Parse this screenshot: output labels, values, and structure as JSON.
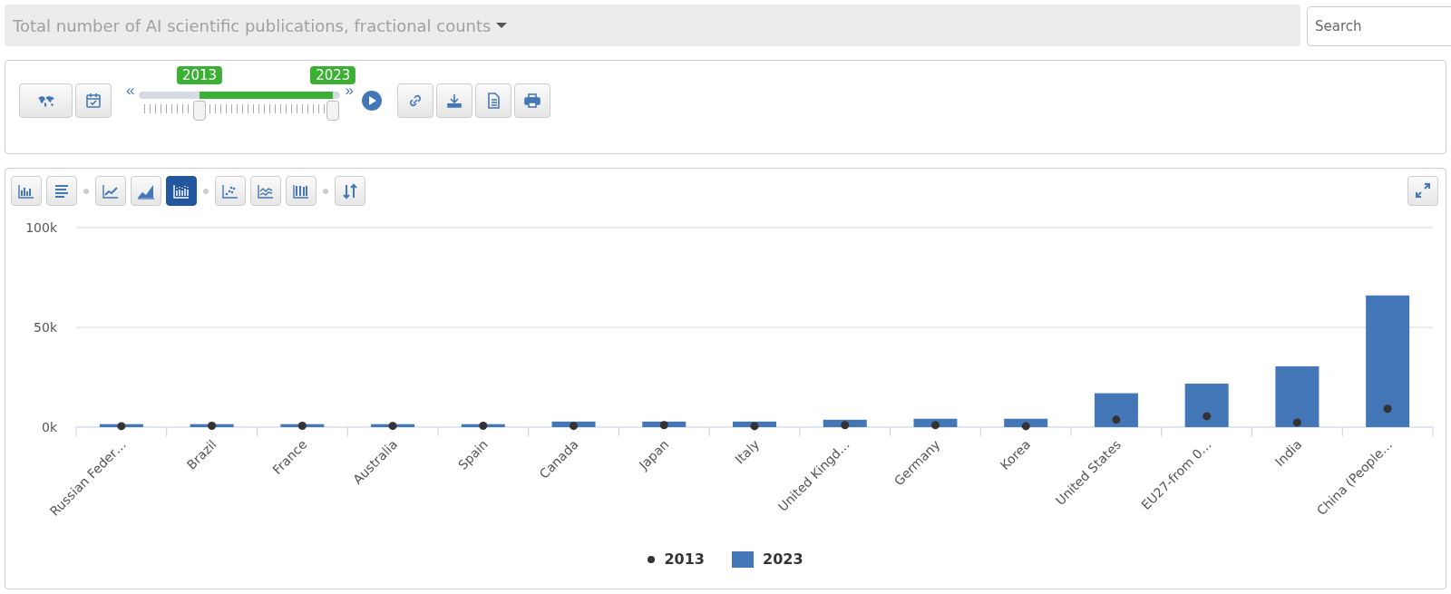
{
  "selector": {
    "title": "Total number of AI scientific publications, fractional counts"
  },
  "search": {
    "placeholder": "Search"
  },
  "range_slider": {
    "prev": "«",
    "next": "»",
    "handles": [
      {
        "label": "2013",
        "level": 0.3
      },
      {
        "label": "2023",
        "level": 0.963
      }
    ]
  },
  "chart_type_groups": [
    [
      {
        "kind": "bar",
        "selected": false
      },
      {
        "kind": "hbar",
        "selected": false
      }
    ],
    [
      {
        "kind": "line",
        "selected": false
      },
      {
        "kind": "area",
        "selected": false
      },
      {
        "kind": "dotbar",
        "selected": true
      }
    ],
    [
      {
        "kind": "scatter",
        "selected": false
      },
      {
        "kind": "multiline",
        "selected": false
      },
      {
        "kind": "stacked",
        "selected": false
      }
    ],
    [
      {
        "kind": "sort",
        "selected": false
      }
    ]
  ],
  "chart": {
    "chart_data": {
      "type": "bar",
      "categories": [
        "Russian Feder…",
        "Brazil",
        "France",
        "Australia",
        "Spain",
        "Canada",
        "Japan",
        "Italy",
        "United Kingd…",
        "Germany",
        "Korea",
        "United States",
        "EU27-from 0…",
        "India",
        "China (People…"
      ],
      "ylim": [
        0,
        100000
      ],
      "yticks": [
        {
          "value": 0,
          "label": "0k"
        },
        {
          "value": 50000,
          "label": "50k"
        },
        {
          "value": 100000,
          "label": "100k"
        }
      ],
      "series": [
        {
          "name": "2013",
          "type": "scatter",
          "color": "#333333",
          "values": [
            500,
            700,
            700,
            600,
            700,
            600,
            1000,
            500,
            1000,
            1000,
            500,
            3700,
            5500,
            2300,
            9200
          ]
        },
        {
          "name": "2023",
          "type": "bar",
          "color": "#4477b8",
          "values": [
            1500,
            1500,
            1500,
            1500,
            1500,
            2800,
            2800,
            2800,
            3700,
            4200,
            4200,
            17000,
            21800,
            30500,
            66000
          ]
        }
      ]
    }
  }
}
